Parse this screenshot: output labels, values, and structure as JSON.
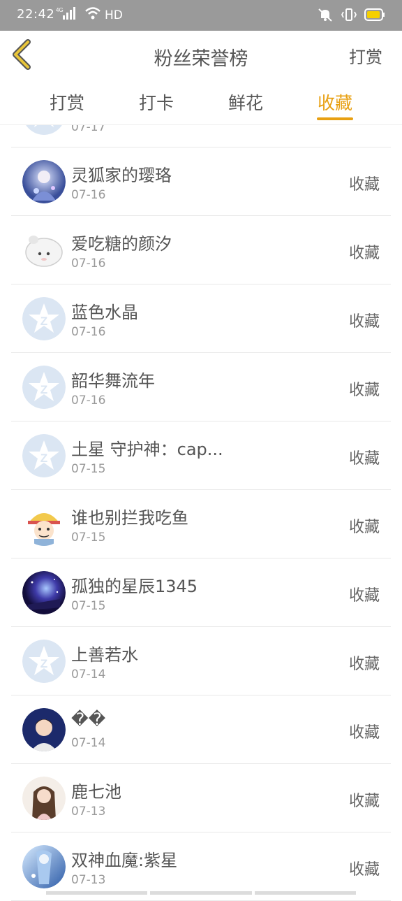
{
  "status": {
    "time": "22:42",
    "network": "4G",
    "hd": "HD"
  },
  "header": {
    "title": "粉丝荣誉榜",
    "right_action": "打赏"
  },
  "tabs": [
    {
      "label": "打赏"
    },
    {
      "label": "打卡"
    },
    {
      "label": "鲜花"
    },
    {
      "label": "收藏"
    }
  ],
  "active_tab": "收藏",
  "list": {
    "partial": {
      "date": "07-17"
    },
    "items": [
      {
        "name": "灵狐家的璎珞",
        "date": "07-16",
        "action": "收藏",
        "avatar": "anime-girl"
      },
      {
        "name": "爱吃糖的颜汐",
        "date": "07-16",
        "action": "收藏",
        "avatar": "hamster"
      },
      {
        "name": "蓝色水晶",
        "date": "07-16",
        "action": "收藏",
        "avatar": "default"
      },
      {
        "name": "韶华舞流年",
        "date": "07-16",
        "action": "收藏",
        "avatar": "default"
      },
      {
        "name": "土星 守护神：cap...",
        "date": "07-15",
        "action": "收藏",
        "avatar": "default"
      },
      {
        "name": "谁也别拦我吃鱼",
        "date": "07-15",
        "action": "收藏",
        "avatar": "pirate"
      },
      {
        "name": "孤独的星辰1345",
        "date": "07-15",
        "action": "收藏",
        "avatar": "galaxy"
      },
      {
        "name": "上善若水",
        "date": "07-14",
        "action": "收藏",
        "avatar": "default"
      },
      {
        "name": "��",
        "date": "07-14",
        "action": "收藏",
        "avatar": "boy"
      },
      {
        "name": "鹿七池",
        "date": "07-13",
        "action": "收藏",
        "avatar": "girl"
      },
      {
        "name": "双神血魔:紫星",
        "date": "07-13",
        "action": "收藏",
        "avatar": "anime-blue"
      }
    ]
  },
  "colors": {
    "accent": "#e8a012",
    "statusbar": "#9a9a9a",
    "battery": "#f5d000",
    "default_avatar": "#dbe6f3"
  }
}
